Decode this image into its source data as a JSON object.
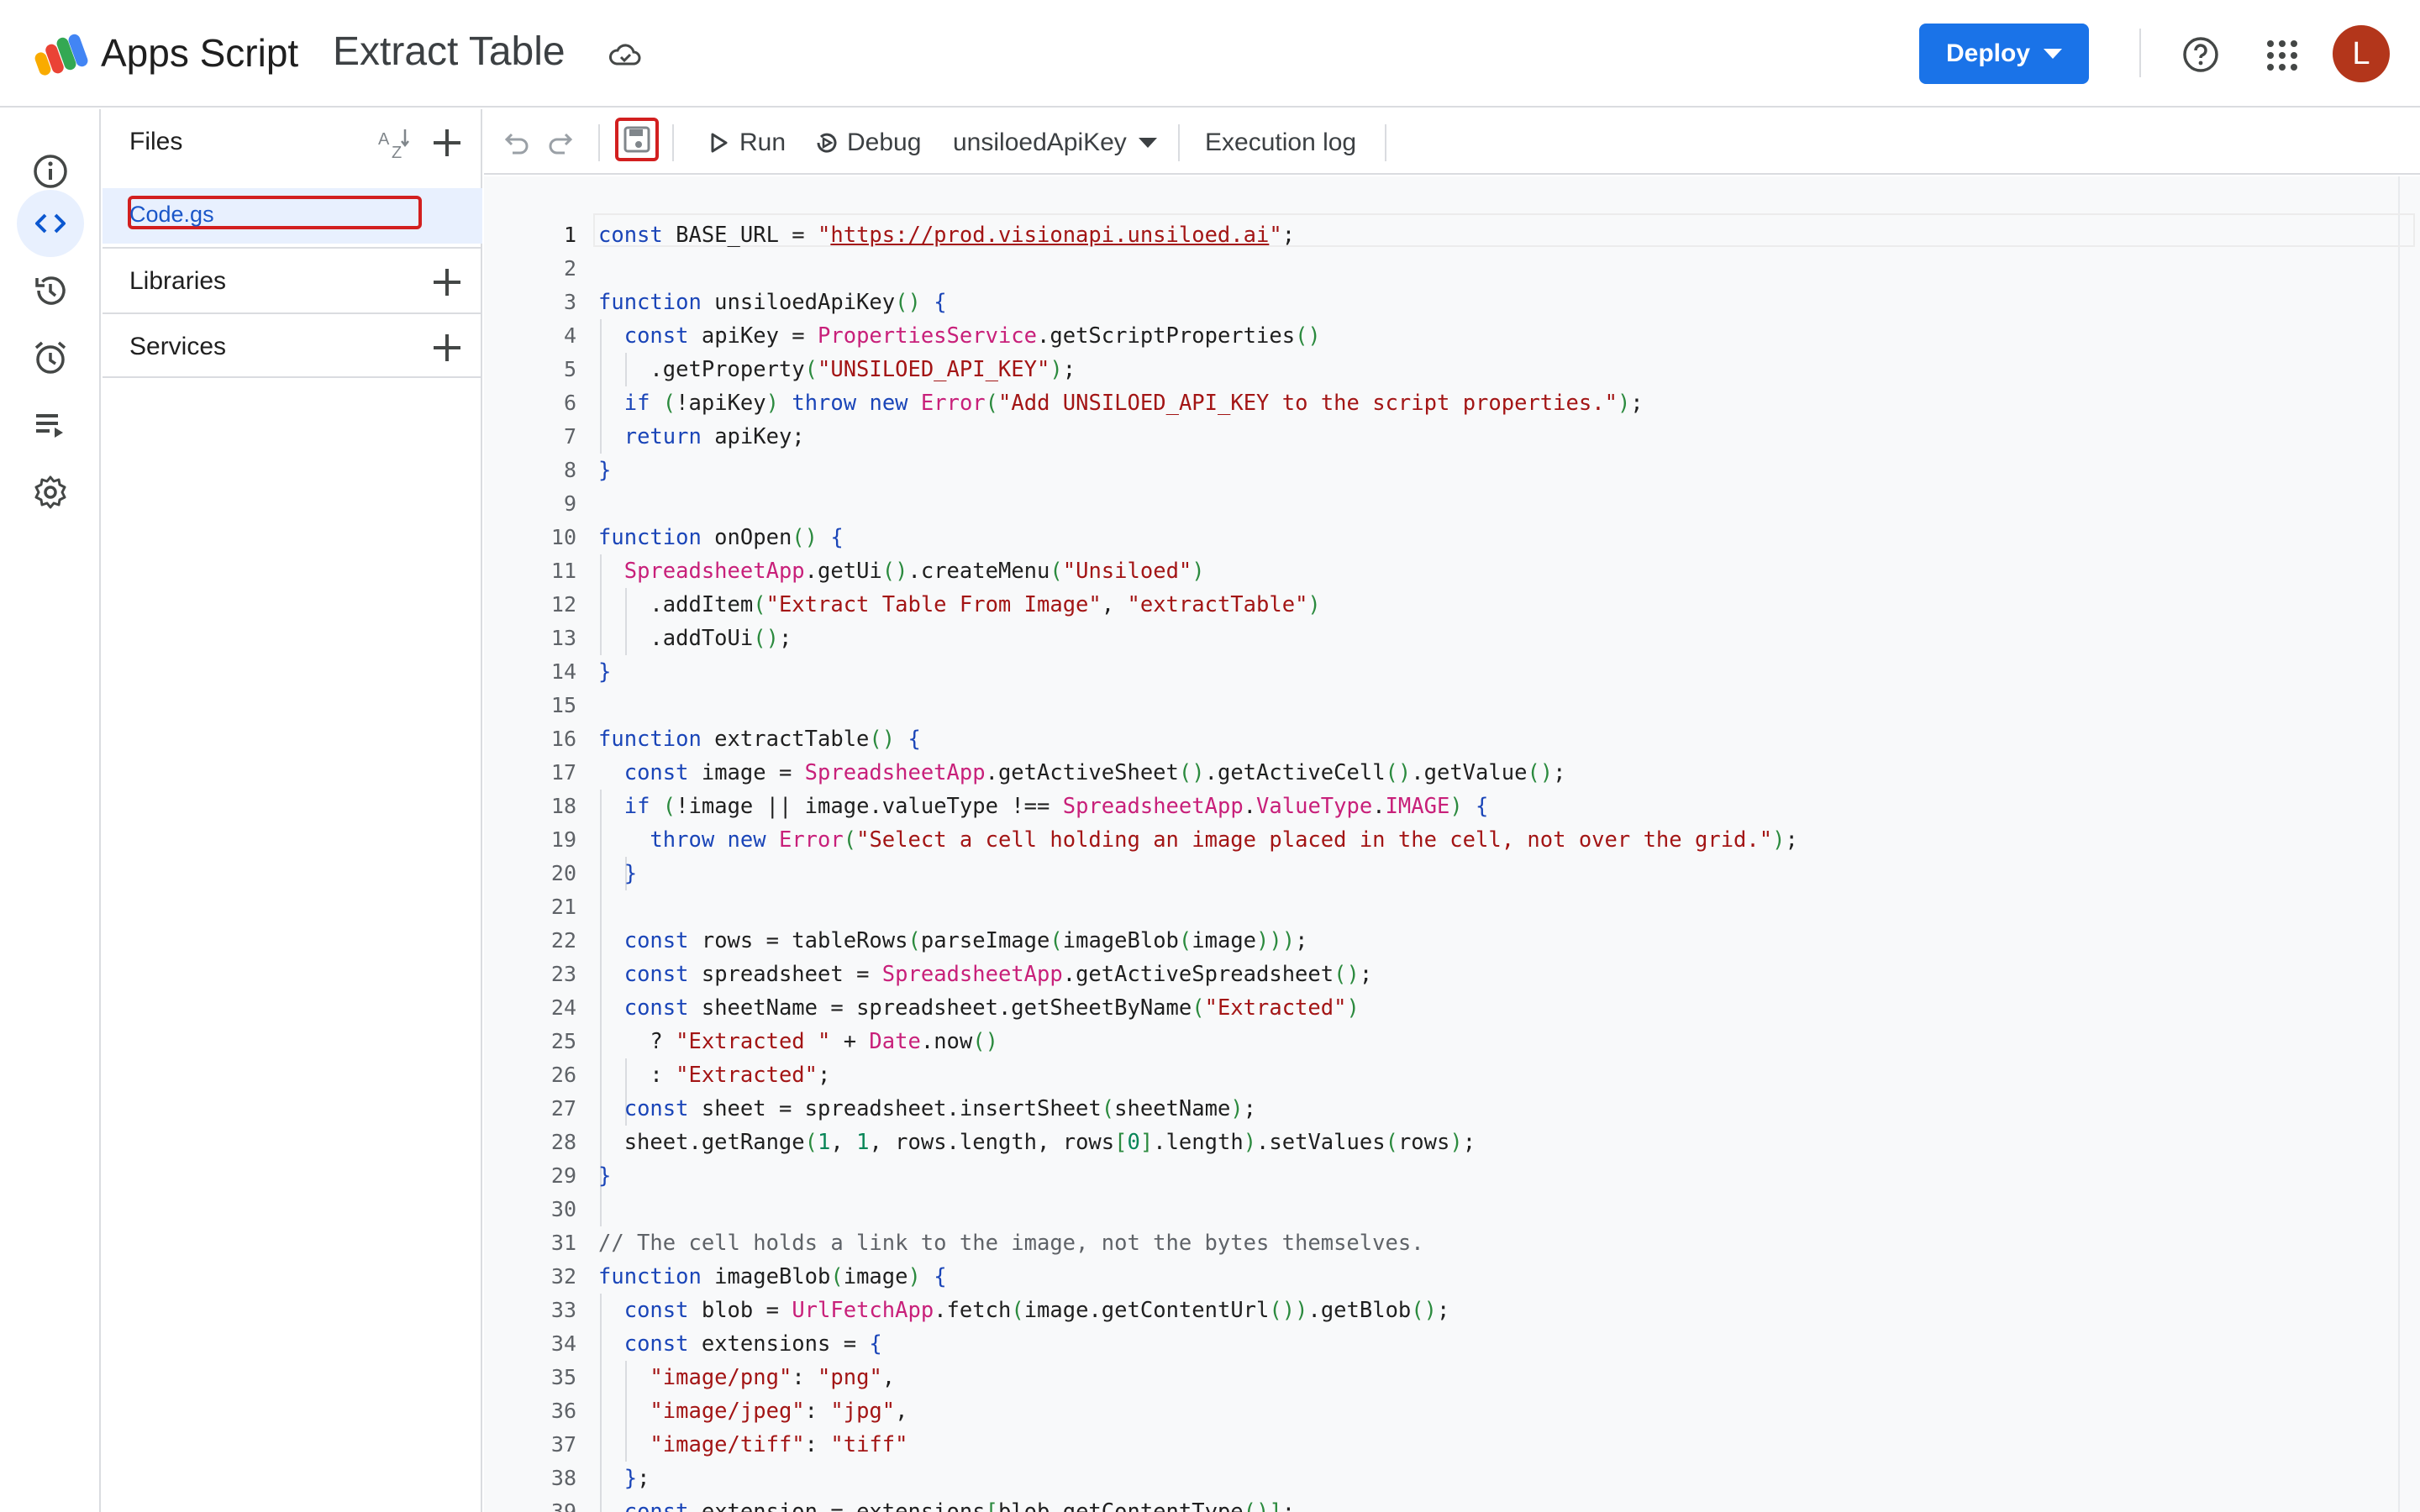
{
  "header": {
    "app_name": "Apps Script",
    "project_title": "Extract Table",
    "deploy_label": "Deploy",
    "avatar_initial": "L",
    "colors": {
      "deploy": "#1a73e8",
      "avatar": "#b3361b",
      "highlight_box": "#d21f1f"
    }
  },
  "files_panel": {
    "title": "Files",
    "files": [
      {
        "name": "Code.gs",
        "selected": true
      }
    ],
    "sections": [
      {
        "label": "Libraries"
      },
      {
        "label": "Services"
      }
    ]
  },
  "toolbar": {
    "run_label": "Run",
    "debug_label": "Debug",
    "function_selector": "unsiloedApiKey",
    "execution_log_label": "Execution log"
  },
  "rail": {
    "items": [
      "info-icon",
      "code-icon",
      "history-icon",
      "alarm-icon",
      "executions-icon",
      "settings-icon"
    ],
    "active": "code-icon"
  },
  "editor": {
    "current_line": 1,
    "lines": [
      "const BASE_URL = \"https://prod.visionapi.unsiloed.ai\";",
      "",
      "function unsiloedApiKey() {",
      "  const apiKey = PropertiesService.getScriptProperties()",
      "    .getProperty(\"UNSILOED_API_KEY\");",
      "  if (!apiKey) throw new Error(\"Add UNSILOED_API_KEY to the script properties.\");",
      "  return apiKey;",
      "}",
      "",
      "function onOpen() {",
      "  SpreadsheetApp.getUi().createMenu(\"Unsiloed\")",
      "    .addItem(\"Extract Table From Image\", \"extractTable\")",
      "    .addToUi();",
      "}",
      "",
      "function extractTable() {",
      "  const image = SpreadsheetApp.getActiveSheet().getActiveCell().getValue();",
      "  if (!image || image.valueType !== SpreadsheetApp.ValueType.IMAGE) {",
      "    throw new Error(\"Select a cell holding an image placed in the cell, not over the grid.\");",
      "  }",
      "",
      "  const rows = tableRows(parseImage(imageBlob(image)));",
      "  const spreadsheet = SpreadsheetApp.getActiveSpreadsheet();",
      "  const sheetName = spreadsheet.getSheetByName(\"Extracted\")",
      "    ? \"Extracted \" + Date.now()",
      "    : \"Extracted\";",
      "  const sheet = spreadsheet.insertSheet(sheetName);",
      "  sheet.getRange(1, 1, rows.length, rows[0].length).setValues(rows);",
      "}",
      "",
      "// The cell holds a link to the image, not the bytes themselves.",
      "function imageBlob(image) {",
      "  const blob = UrlFetchApp.fetch(image.getContentUrl()).getBlob();",
      "  const extensions = {",
      "    \"image/png\": \"png\",",
      "    \"image/jpeg\": \"jpg\",",
      "    \"image/tiff\": \"tiff\"",
      "  };",
      "  const extension = extensions[blob.getContentType()];"
    ]
  }
}
